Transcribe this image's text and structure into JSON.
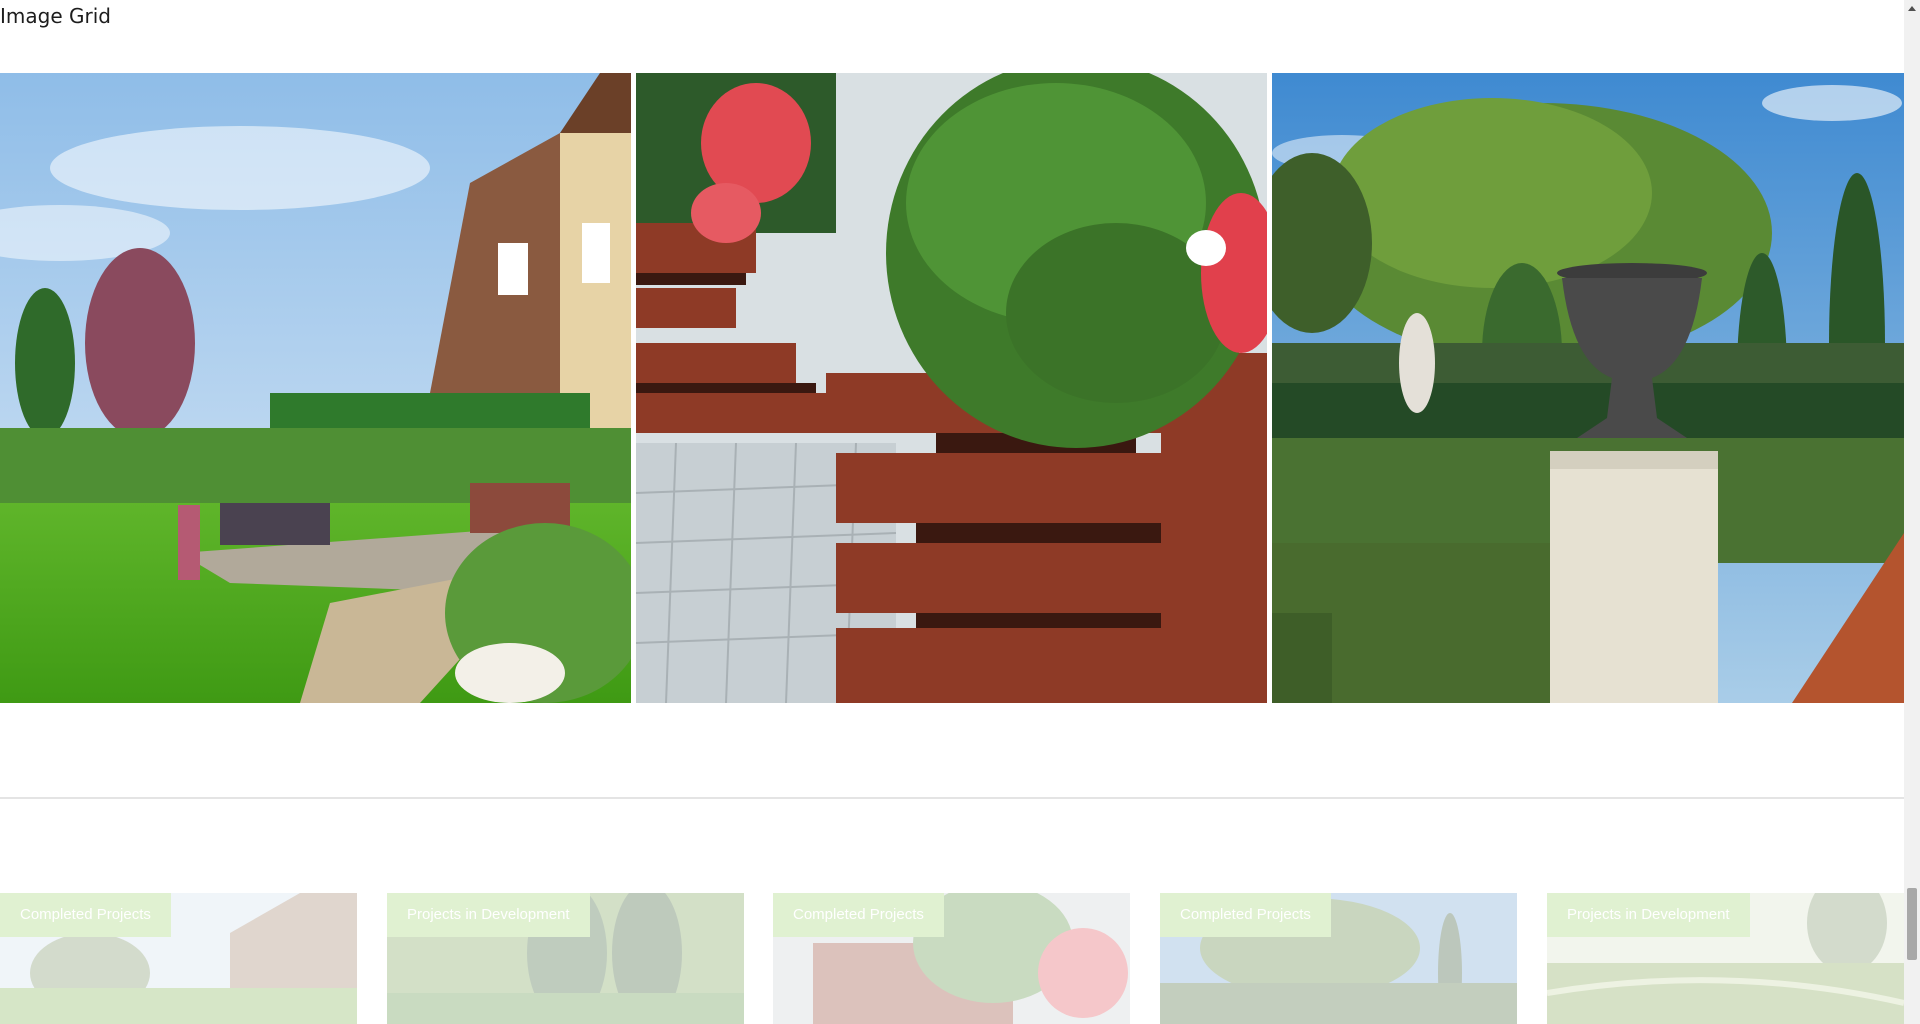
{
  "heading": "Image Grid",
  "grid_images": [
    {
      "name": "backyard-patio-lawn-image"
    },
    {
      "name": "wooden-planter-box-image"
    },
    {
      "name": "formal-garden-urn-image"
    }
  ],
  "projects": [
    {
      "label": "Completed Projects"
    },
    {
      "label": "Projects in Development"
    },
    {
      "label": "Completed Projects"
    },
    {
      "label": "Completed Projects"
    },
    {
      "label": "Projects in Development"
    }
  ],
  "colors": {
    "badge_background": "#9cd46a",
    "badge_text": "#ffffff",
    "divider": "#e4e4e4",
    "page_background": "#ffffff"
  },
  "icons": {
    "scroll_up": "triangle-up-icon"
  }
}
